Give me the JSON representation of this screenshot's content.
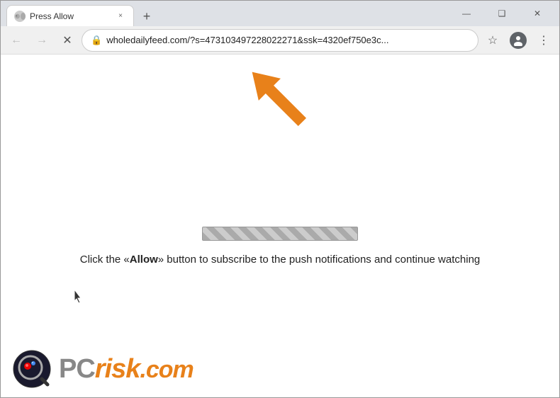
{
  "window": {
    "title": "Press Allow",
    "tab": {
      "favicon_alt": "tab-favicon",
      "title": "Press Allow",
      "close_label": "×"
    },
    "new_tab_label": "+",
    "controls": {
      "minimize": "—",
      "maximize": "❑",
      "close": "✕"
    }
  },
  "toolbar": {
    "back_label": "←",
    "forward_label": "→",
    "reload_label": "✕",
    "address": "wholedailyfeed.com/?s=473103497228022271&ssk=4320ef750e3c...",
    "lock_icon": "🔒",
    "star_label": "☆",
    "profile_label": "👤",
    "menu_label": "⋮"
  },
  "page": {
    "cta_text_before": "Click the «",
    "cta_allow": "Allow",
    "cta_text_after": "» button to subscribe to the push notifications and continue watching"
  },
  "watermark": {
    "pc_label": "PC",
    "risk_label": "risk",
    "com_label": ".com"
  }
}
